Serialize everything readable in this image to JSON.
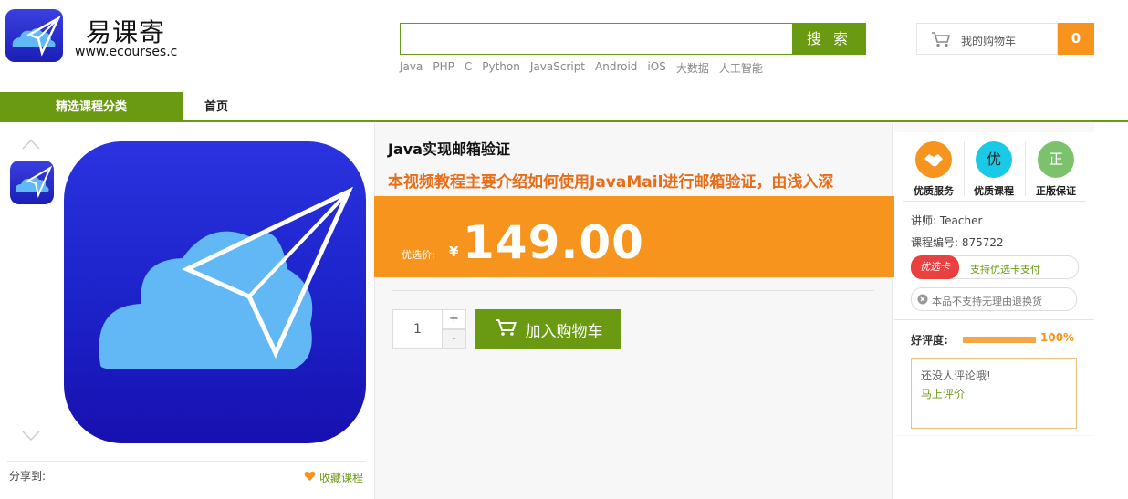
{
  "header": {
    "logo_name": "易课寄",
    "logo_url": "www.ecourses.c",
    "search": {
      "placeholder": "",
      "button_label": "搜 索"
    },
    "hot_words": [
      "Java",
      "PHP",
      "C",
      "Python",
      "JavaScript",
      "Android",
      "iOS",
      "大数据",
      "人工智能"
    ],
    "cart": {
      "label": "我的购物车",
      "count": "0"
    }
  },
  "nav": {
    "category_label": "精选课程分类",
    "home_label": "首页"
  },
  "gallery": {
    "share_label": "分享到:",
    "favorite_label": "收藏课程"
  },
  "product": {
    "title": "Java实现邮箱验证",
    "subtitle": "本视频教程主要介绍如何使用JavaMail进行邮箱验证，由浅入深",
    "price_label": "优选价:",
    "currency": "¥",
    "price": "149.00",
    "quantity": "1",
    "plus": "+",
    "minus": "-",
    "add_to_cart_label": "加入购物车"
  },
  "sidebar": {
    "features": [
      {
        "label": "优质服务",
        "icon": "handshake-icon",
        "color": "#f7941d"
      },
      {
        "label": "优质课程",
        "glyph": "优",
        "color": "#19c9e6"
      },
      {
        "label": "正版保证",
        "glyph": "正",
        "color": "#7cc26d"
      }
    ],
    "teacher_label": "讲师:",
    "teacher": "Teacher",
    "course_no_label": "课程编号:",
    "course_no": "875722",
    "card_badge": "优选卡",
    "card_text": "支持优选卡支付",
    "refund_text": "本品不支持无理由退换货",
    "rating_label": "好评度:",
    "rating_value": "100%",
    "rating_fraction": 1.0,
    "no_review_text": "还没人评论哦!",
    "review_link": "马上评价"
  },
  "colors": {
    "brand_green": "#6a9a12",
    "accent_orange": "#f7941d",
    "title_orange": "#e96c17"
  }
}
